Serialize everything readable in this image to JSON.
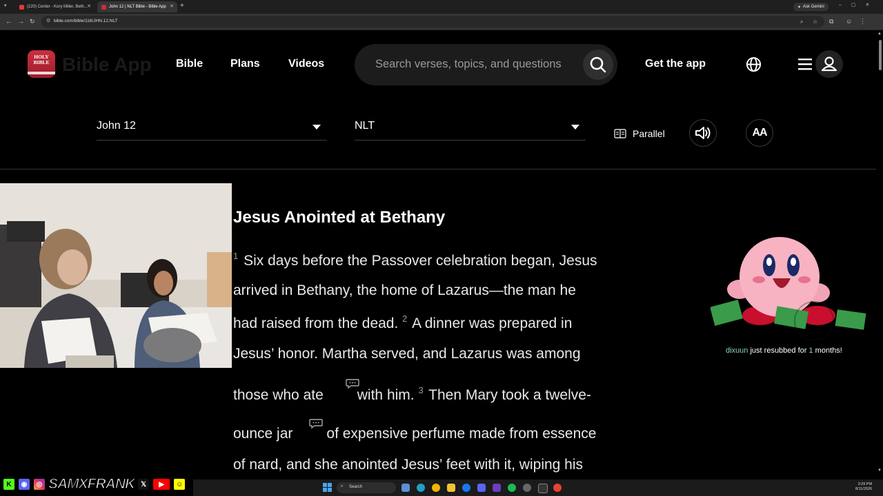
{
  "browser": {
    "tabs": [
      {
        "title": "(220) Center - Kory Miller, Beth..."
      },
      {
        "title": "John 12 | NLT Bible - Bible App"
      }
    ],
    "ask_gemini": "Ask Gemini",
    "url": "bible.com/bible/116/JHN.12.NLT"
  },
  "header": {
    "logo_text": "HOLY BIBLE",
    "brand": "Bible App",
    "nav": [
      "Bible",
      "Plans",
      "Videos"
    ],
    "search_placeholder": "Search verses, topics, and questions",
    "get_app": "Get the app"
  },
  "reader": {
    "book_chapter": "John 12",
    "version": "NLT",
    "parallel_label": "Parallel",
    "font_size_label": "AA",
    "section_heading": "Jesus Anointed at Bethany",
    "lines": [
      {
        "verse": "1",
        "text": " Six days before the Passover celebration began, Jesus"
      },
      {
        "text": "arrived in Bethany, the home of Lazarus—the man he"
      },
      {
        "text": "had raised from the dead. ",
        "verse_after": "2",
        "text2": " A dinner was prepared in"
      },
      {
        "text": "Jesus’ honor. Martha served, and Lazarus was among"
      },
      {
        "text": "those who ate",
        "text2": "with him. ",
        "verse_after": "3",
        "text3": " Then Mary took a twelve-"
      },
      {
        "text": "ounce jar",
        "text2": "of expensive perfume made from essence"
      },
      {
        "text": "of nard, and she anointed Jesus’ feet with it, wiping his"
      }
    ]
  },
  "stream_alert": {
    "username": "dixuun",
    "middle": "just resubbed for",
    "months": "1",
    "suffix": "months!"
  },
  "stream_overlay": {
    "channel_name": "SAMXFRANK",
    "socials": [
      "kick-icon",
      "discord-icon",
      "instagram-icon",
      "x-icon",
      "youtube-icon",
      "snapchat-icon"
    ]
  },
  "taskbar": {
    "search_label": "Search",
    "time": "3:29 PM",
    "date": "8/11/2026"
  }
}
